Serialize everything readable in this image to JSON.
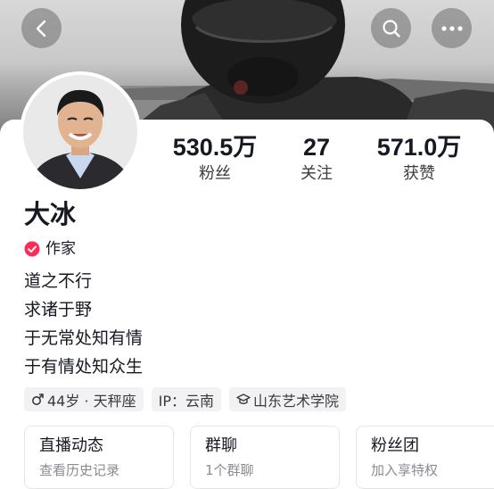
{
  "profile": {
    "name": "大冰",
    "verification": "作家",
    "bio": [
      "道之不行",
      "求诸于野",
      "于无常处知有情",
      "于有情处知众生"
    ]
  },
  "stats": {
    "fans": {
      "value": "530.5万",
      "label": "粉丝"
    },
    "following": {
      "value": "27",
      "label": "关注"
    },
    "likes": {
      "value": "571.0万",
      "label": "获赞"
    }
  },
  "tags": {
    "age": "44岁 · 天秤座",
    "ip": "IP：云南",
    "school": "山东艺术学院"
  },
  "entries": [
    {
      "title": "直播动态",
      "subtitle": "查看历史记录"
    },
    {
      "title": "群聊",
      "subtitle": "1个群聊"
    },
    {
      "title": "粉丝团",
      "subtitle": "加入享特权"
    }
  ],
  "icons": {
    "back": "chevron-left-icon",
    "search": "search-icon",
    "more": "more-dots-icon",
    "verified": "verified-badge-icon",
    "gender": "male-icon",
    "school": "graduation-cap-icon"
  },
  "colors": {
    "verified_badge": "#fe2c55",
    "tag_background": "#f2f2f4",
    "text_primary": "#161823",
    "text_secondary": "#8a8b91"
  }
}
